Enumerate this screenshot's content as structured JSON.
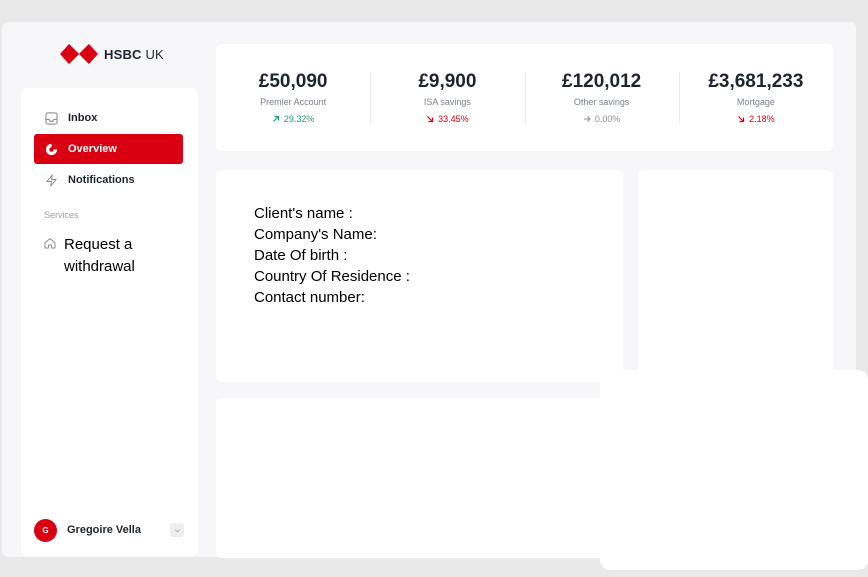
{
  "logo": {
    "brand_bold": "HSBC",
    "brand_light": "UK"
  },
  "sidebar": {
    "items": [
      {
        "label": "Inbox",
        "icon": "inbox-icon"
      },
      {
        "label": "Overview",
        "icon": "pie-chart-icon",
        "active": true
      },
      {
        "label": "Notifications",
        "icon": "lightning-icon"
      }
    ],
    "services_label": "Services",
    "request": {
      "label": "Request a withdrawal",
      "icon": "home-icon"
    },
    "user": {
      "initial": "G",
      "name": "Gregoire Vella"
    }
  },
  "stats": [
    {
      "value": "£50,090",
      "label": "Premier Account",
      "change": "29.32%",
      "trend": "up"
    },
    {
      "value": "£9,900",
      "label": "ISA savings",
      "change": "33.45%",
      "trend": "down"
    },
    {
      "value": "£120,012",
      "label": "Other savings",
      "change": "0.00%",
      "trend": "flat"
    },
    {
      "value": "£3,681,233",
      "label": "Mortgage",
      "change": "2.18%",
      "trend": "down"
    }
  ],
  "client": {
    "name_label": "Client's name :",
    "company_label": "Company's Name:",
    "dob_label": "Date Of birth :",
    "country_label": "Country Of Residence :",
    "contact_label": "Contact number:"
  },
  "colors": {
    "brand_red": "#db0011",
    "up_green": "#1da06b",
    "flat_gray": "#8a8f99"
  }
}
